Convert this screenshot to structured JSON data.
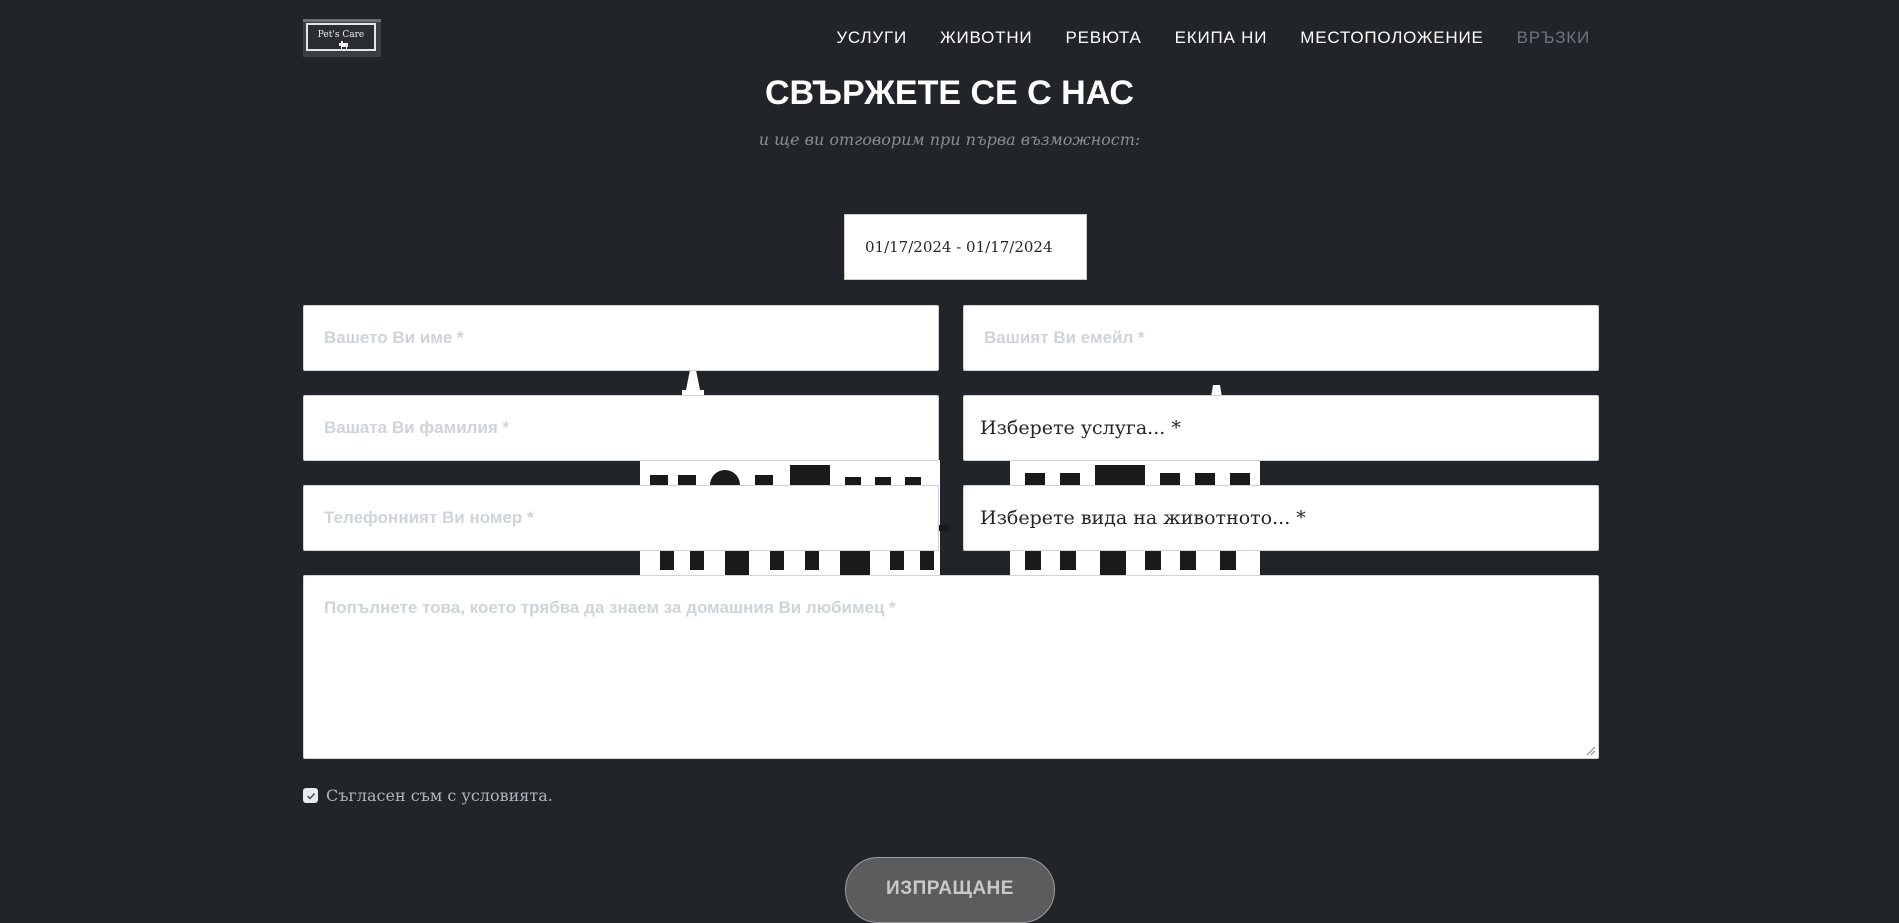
{
  "logo": {
    "text": "Pet's Care",
    "icon": "dog-icon"
  },
  "nav": {
    "items": [
      {
        "label": "УСЛУГИ"
      },
      {
        "label": "ЖИВОТНИ"
      },
      {
        "label": "РЕВЮТА"
      },
      {
        "label": "ЕКИПА НИ"
      },
      {
        "label": "МЕСТОПОЛОЖЕНИЕ"
      },
      {
        "label": "ВРЪЗКИ"
      }
    ],
    "active": "ВРЪЗКИ"
  },
  "contact": {
    "title": "СВЪРЖЕТЕ СЕ С НАС",
    "subtitle": "и ще ви отговорим при първа възможност:",
    "date_range": "01/17/2024 - 01/17/2024"
  },
  "form": {
    "name_placeholder": "Вашето Ви име *",
    "email_placeholder": "Вашият Ви емейл *",
    "lastname_placeholder": "Вашата Ви фамилия *",
    "service_select": "Изберете услуга... *",
    "phone_placeholder": "Телефонният Ви номер *",
    "animal_select": "Изберете вида на животното... *",
    "message_placeholder": "Попълнете това, което трябва да знаем за домашния Ви любимец *",
    "consent_label": "Съгласен съм с условията.",
    "consent_checked": true,
    "submit_label": "ИЗПРАЩАНЕ"
  },
  "colors": {
    "background": "#212529",
    "nav_active": "#6c757d",
    "placeholder": "#ced4da",
    "button": "#5a5c5e"
  }
}
